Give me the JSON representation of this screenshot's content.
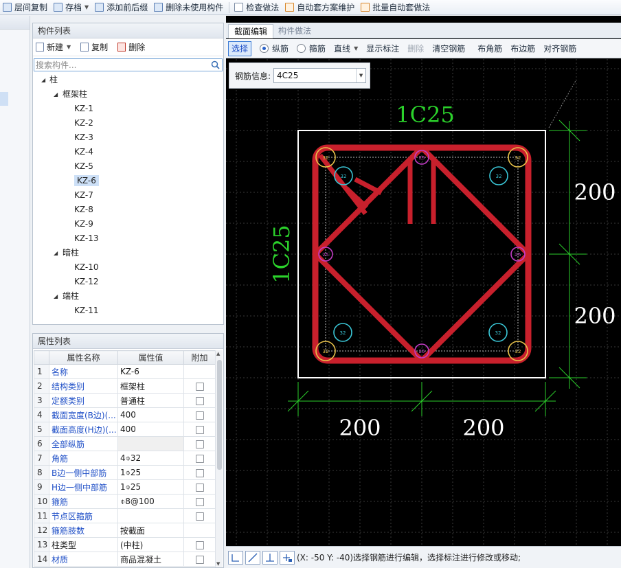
{
  "toolbar": {
    "items": [
      {
        "label": "层间复制",
        "icon": "copy-floor-icon",
        "has_dropdown": false
      },
      {
        "label": "存档",
        "icon": "archive-icon",
        "has_dropdown": true
      },
      {
        "label": "添加前后缀",
        "icon": "add-prefix-suffix-icon",
        "has_dropdown": false
      },
      {
        "label": "删除未使用构件",
        "icon": "delete-unused-icon",
        "has_dropdown": false
      },
      {
        "label": "检查做法",
        "icon": "check-method-icon",
        "has_dropdown": false
      },
      {
        "label": "自动套方案维护",
        "icon": "auto-scheme-icon",
        "has_dropdown": false
      },
      {
        "label": "批量自动套做法",
        "icon": "batch-auto-icon",
        "has_dropdown": false
      }
    ]
  },
  "component_panel": {
    "title": "构件列表",
    "new_label": "新建",
    "copy_label": "复制",
    "delete_label": "删除",
    "search_placeholder": "搜索构件..."
  },
  "tree": {
    "root": "柱",
    "groups": [
      {
        "label": "框架柱",
        "items": [
          "KZ-1",
          "KZ-2",
          "KZ-3",
          "KZ-4",
          "KZ-5",
          "KZ-6",
          "KZ-7",
          "KZ-8",
          "KZ-9",
          "KZ-13"
        ]
      },
      {
        "label": "暗柱",
        "items": [
          "KZ-10",
          "KZ-12"
        ]
      },
      {
        "label": "端柱",
        "items": [
          "KZ-11"
        ]
      }
    ],
    "selected": "KZ-6"
  },
  "property_panel": {
    "title": "属性列表",
    "headers": {
      "name": "属性名称",
      "value": "属性值",
      "extra": "附加"
    },
    "rows": [
      {
        "idx": "1",
        "name": "名称",
        "value": "KZ-6",
        "blue": true,
        "checkbox": false
      },
      {
        "idx": "2",
        "name": "结构类别",
        "value": "框架柱",
        "blue": true,
        "checkbox": true
      },
      {
        "idx": "3",
        "name": "定额类别",
        "value": "普通柱",
        "blue": true,
        "checkbox": true
      },
      {
        "idx": "4",
        "name": "截面宽度(B边)(...",
        "value": "400",
        "blue": true,
        "checkbox": true
      },
      {
        "idx": "5",
        "name": "截面高度(H边)(...",
        "value": "400",
        "blue": true,
        "checkbox": true
      },
      {
        "idx": "6",
        "name": "全部纵筋",
        "value": "",
        "blue": true,
        "checkbox": true,
        "gray": true
      },
      {
        "idx": "7",
        "name": "角筋",
        "value": "4⌽32",
        "blue": true,
        "checkbox": true
      },
      {
        "idx": "8",
        "name": "B边一侧中部筋",
        "value": "1⌽25",
        "blue": true,
        "checkbox": true
      },
      {
        "idx": "9",
        "name": "H边一侧中部筋",
        "value": "1⌽25",
        "blue": true,
        "checkbox": true
      },
      {
        "idx": "10",
        "name": "箍筋",
        "value": "⌽8@100",
        "blue": true,
        "checkbox": true
      },
      {
        "idx": "11",
        "name": "节点区箍筋",
        "value": "",
        "blue": true,
        "checkbox": true
      },
      {
        "idx": "12",
        "name": "箍筋肢数",
        "value": "按截面",
        "blue": true,
        "checkbox": false
      },
      {
        "idx": "13",
        "name": "柱类型",
        "value": "(中柱)",
        "blue": false,
        "checkbox": true
      },
      {
        "idx": "14",
        "name": "材质",
        "value": "商品混凝土",
        "blue": true,
        "checkbox": true
      }
    ]
  },
  "editor": {
    "tabs": [
      "截面编辑",
      "构件做法"
    ],
    "active_tab": "截面编辑",
    "toolbar": {
      "select": "选择",
      "longitudinal": "纵筋",
      "stirrup": "箍筋",
      "line": "直线",
      "show_label": "显示标注",
      "delete": "删除",
      "clear": "清空钢筋",
      "corner": "布角筋",
      "edge": "布边筋",
      "align": "对齐钢筋"
    },
    "radio_selected": "纵筋",
    "rebar_info_label": "钢筋信息:",
    "rebar_info_value": "4C25"
  },
  "drawing": {
    "top_label": "1C25",
    "left_label": "1C25",
    "right_dims": [
      "200",
      "200"
    ],
    "bottom_dims": [
      "200",
      "200"
    ],
    "corner_bar": "32",
    "mid_bar": "25",
    "stirrup_bar": "32",
    "colors": {
      "outline": "#ffffff",
      "stirrup": "#c8202c",
      "corner": "#e8c24a",
      "mid": "#c23cc6",
      "inner": "#3ac6d6",
      "dim": "#2bd12b",
      "text": "#ffffff",
      "label": "#2bd12b"
    }
  },
  "status": {
    "text": "(X: -50 Y: -40)选择钢筋进行编辑，选择标注进行修改或移动;"
  }
}
